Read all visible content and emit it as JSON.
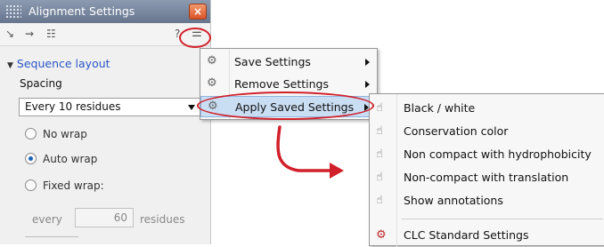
{
  "window": {
    "title": "Alignment Settings",
    "close_label": "×"
  },
  "panel": {
    "section_title": "Sequence layout",
    "spacing_label": "Spacing",
    "spacing_value": "Every 10 residues",
    "wrap_options": [
      {
        "label": "No wrap",
        "checked": false
      },
      {
        "label": "Auto wrap",
        "checked": true
      },
      {
        "label": "Fixed wrap:",
        "checked": false
      }
    ],
    "every_label": "every",
    "every_value": "60",
    "residues_label": "residues"
  },
  "context_menu": {
    "items": [
      {
        "label": "Save Settings",
        "icon": "gear-icon",
        "has_submenu": true
      },
      {
        "label": "Remove Settings",
        "icon": "gear-remove-icon",
        "has_submenu": true
      },
      {
        "label": "Apply Saved Settings",
        "icon": "gear-apply-icon",
        "has_submenu": true,
        "active": true
      }
    ]
  },
  "submenu": {
    "items": [
      {
        "label": "Black / white",
        "icon": "settings-hand-icon"
      },
      {
        "label": "Conservation color",
        "icon": "settings-hand-icon"
      },
      {
        "label": "Non compact with hydrophobicity",
        "icon": "settings-hand-icon"
      },
      {
        "label": "Non-compact with translation",
        "icon": "settings-hand-icon"
      },
      {
        "label": "Show annotations",
        "icon": "settings-hand-icon"
      },
      {
        "label": "CLC Standard Settings",
        "icon": "clc-settings-icon"
      }
    ]
  },
  "colors": {
    "annotation_red": "#d1202a",
    "link_blue": "#2a56c6",
    "highlight": "#c9ddf3"
  }
}
